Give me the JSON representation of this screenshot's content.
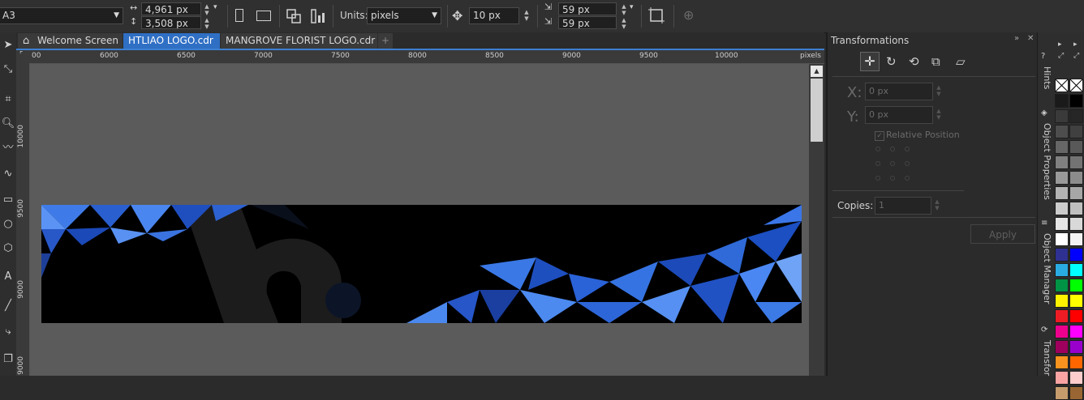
{
  "propbar": {
    "paper_size": "A3",
    "width": "4,961 px",
    "height": "3,508 px",
    "units_label": "Units:",
    "units_value": "pixels",
    "nudge": "10 px",
    "dup_x": "59 px",
    "dup_y": "59 px"
  },
  "tabs": [
    {
      "label": "Welcome Screen"
    },
    {
      "label": "HTLIAO LOGO.cdr"
    },
    {
      "label": "MANGROVE FLORIST LOGO.cdr"
    }
  ],
  "ruler": {
    "h_ticks": [
      "00",
      "6000",
      "6500",
      "7000",
      "7500",
      "8000",
      "8500",
      "9000",
      "9500",
      "10000"
    ],
    "h_unit": "pixels",
    "v_ticks": [
      "10000",
      "9500",
      "9000"
    ]
  },
  "docker": {
    "title": "Transformations",
    "x_label": "X:",
    "x_value": "0 px",
    "y_label": "Y:",
    "y_value": "0 px",
    "relative_position": "Relative Position",
    "copies_label": "Copies:",
    "copies_value": "1",
    "apply_label": "Apply"
  },
  "side_tabs": {
    "hints": "Hints",
    "object_properties": "Object Properties",
    "object_manager": "Object Manager",
    "transform": "Transfor"
  },
  "palette": {
    "left": [
      "#ffffff",
      "#1a1a1a",
      "#3a3a3a",
      "#4d4d4d",
      "#666666",
      "#808080",
      "#999999",
      "#b3b3b3",
      "#cccccc",
      "#e6e6e6",
      "#ffffff",
      "#2e3192",
      "#29abe2",
      "#009245",
      "#fff200",
      "#ed1c24",
      "#ec008c",
      "#9e005d",
      "#f7931e",
      "#f9a3a3",
      "#c69c6d"
    ],
    "right": [
      "#ffffff",
      "#000000",
      "#262626",
      "#404040",
      "#595959",
      "#737373",
      "#8c8c8c",
      "#a6a6a6",
      "#bfbfbf",
      "#d9d9d9",
      "#f2f2f2",
      "#0000ff",
      "#00ffff",
      "#00ff00",
      "#ffff00",
      "#ff0000",
      "#ff00ff",
      "#9900cc",
      "#ff6600",
      "#ffcccc",
      "#996633"
    ]
  }
}
